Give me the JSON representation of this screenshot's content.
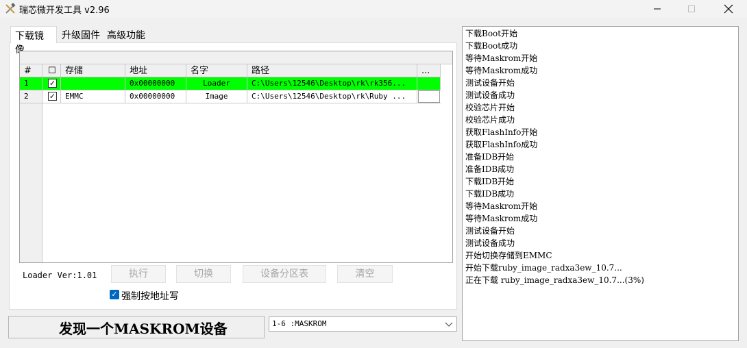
{
  "window": {
    "title": "瑞芯微开发工具 v2.96",
    "icon": "tools-icon"
  },
  "tabs": [
    {
      "label": "下载镜像",
      "active": true
    },
    {
      "label": "升级固件",
      "active": false
    },
    {
      "label": "高级功能",
      "active": false
    }
  ],
  "grid": {
    "headers": {
      "index": "#",
      "check": "☐",
      "storage": "存储",
      "address": "地址",
      "name": "名字",
      "path": "路径",
      "more": "..."
    },
    "rows": [
      {
        "index": "1",
        "checked": true,
        "storage": "",
        "address": "0x00000000",
        "name": "Loader",
        "path": "C:\\Users\\12546\\Desktop\\rk\\rk356...",
        "selected": true
      },
      {
        "index": "2",
        "checked": true,
        "storage": "EMMC",
        "address": "0x00000000",
        "name": "Image",
        "path": "C:\\Users\\12546\\Desktop\\rk\\Ruby ...",
        "selected": false
      }
    ]
  },
  "controls": {
    "loader_ver": "Loader Ver:1.01",
    "run": "执行",
    "switch": "切换",
    "partition_table": "设备分区表",
    "clear": "清空",
    "force_address_write": "强制按地址写",
    "force_checked": true
  },
  "status": {
    "message": "发现一个MASKROM设备",
    "device": "1-6 :MASKROM"
  },
  "log": [
    "下载Boot开始",
    "下载Boot成功",
    "等待Maskrom开始",
    "等待Maskrom成功",
    "测试设备开始",
    "测试设备成功",
    "校验芯片开始",
    "校验芯片成功",
    "获取FlashInfo开始",
    "获取FlashInfo成功",
    "准备IDB开始",
    "准备IDB成功",
    "下载IDB开始",
    "下载IDB成功",
    "等待Maskrom开始",
    "等待Maskrom成功",
    "测试设备开始",
    "测试设备成功",
    "开始切换存储到EMMC",
    "开始下载ruby_image_radxa3ew_10.7...",
    "正在下载 ruby_image_radxa3ew_10.7...(3%)"
  ],
  "colors": {
    "selected_row": "#00ff00",
    "checkbox_accent": "#0067c0"
  }
}
